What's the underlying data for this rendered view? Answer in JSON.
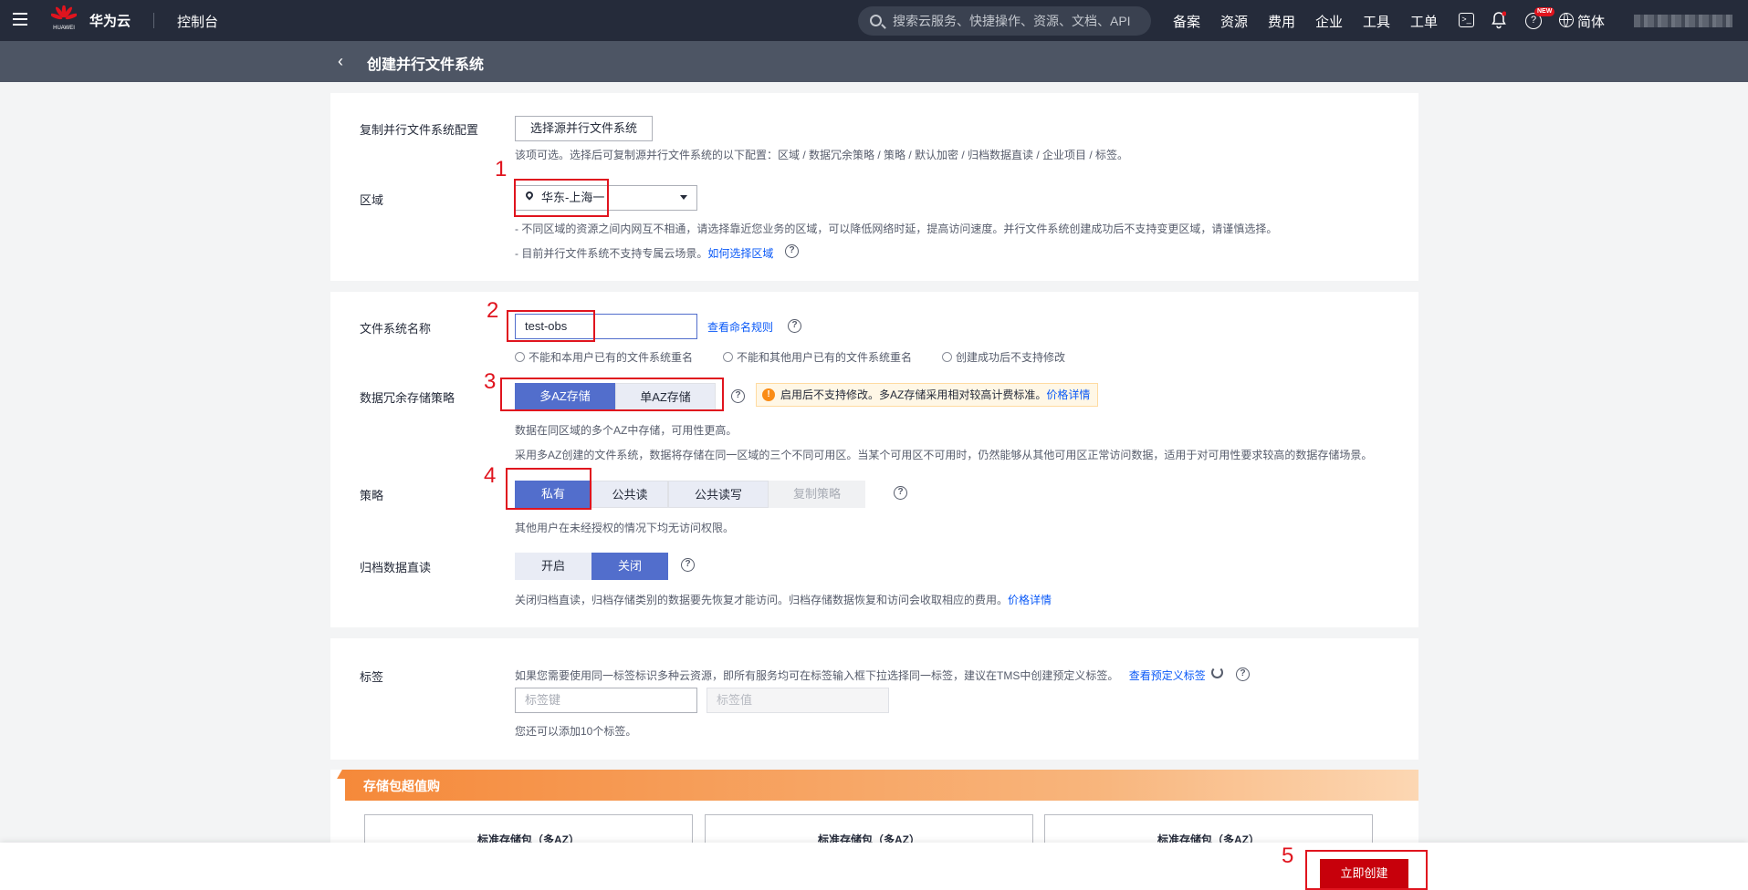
{
  "topnav": {
    "logo_text": "HUAWEI",
    "brand": "华为云",
    "console": "控制台",
    "search_placeholder": "搜索云服务、快捷操作、资源、文档、API",
    "menu": [
      "备案",
      "资源",
      "费用",
      "企业",
      "工具",
      "工单"
    ],
    "new_badge": "NEW",
    "language": "简体"
  },
  "subheader": {
    "title": "创建并行文件系统"
  },
  "copy_config": {
    "label": "复制并行文件系统配置",
    "button": "选择源并行文件系统",
    "hint": "该项可选。选择后可复制源并行文件系统的以下配置：区域 / 数据冗余策略 / 策略 / 默认加密 / 归档数据直读 / 企业项目 / 标签。"
  },
  "region": {
    "label": "区域",
    "value": "华东-上海一",
    "hint1": "- 不同区域的资源之间内网互不相通，请选择靠近您业务的区域，可以降低网络时延，提高访问速度。并行文件系统创建成功后不支持变更区域，请谨慎选择。",
    "hint2": "- 目前并行文件系统不支持专属云场景。",
    "hint2_link": "如何选择区域"
  },
  "fs_name": {
    "label": "文件系统名称",
    "value": "test-obs",
    "rule_link": "查看命名规则",
    "rules": [
      "不能和本用户已有的文件系统重名",
      "不能和其他用户已有的文件系统重名",
      "创建成功后不支持修改"
    ]
  },
  "redundancy": {
    "label": "数据冗余存储策略",
    "options": [
      "多AZ存储",
      "单AZ存储"
    ],
    "warning": "启用后不支持修改。多AZ存储采用相对较高计费标准。",
    "warning_link": "价格详情",
    "hint1": "数据在同区域的多个AZ中存储，可用性更高。",
    "hint2": "采用多AZ创建的文件系统，数据将存储在同一区域的三个不同可用区。当某个可用区不可用时，仍然能够从其他可用区正常访问数据，适用于对可用性要求较高的数据存储场景。"
  },
  "policy": {
    "label": "策略",
    "options": [
      "私有",
      "公共读",
      "公共读写",
      "复制策略"
    ],
    "hint": "其他用户在未经授权的情况下均无访问权限。"
  },
  "archive": {
    "label": "归档数据直读",
    "options": [
      "开启",
      "关闭"
    ],
    "hint": "关闭归档直读，归档存储类别的数据要先恢复才能访问。归档存储数据恢复和访问会收取相应的费用。",
    "hint_link": "价格详情"
  },
  "tags": {
    "label": "标签",
    "hint": "如果您需要使用同一标签标识多种云资源，即所有服务均可在标签输入框下拉选择同一标签，建议在TMS中创建预定义标签。",
    "link": "查看预定义标签",
    "key_placeholder": "标签键",
    "value_placeholder": "标签值",
    "more_hint": "您还可以添加10个标签。"
  },
  "package": {
    "banner": "存储包超值购",
    "cards": [
      "标准存储包（多AZ）",
      "标准存储包（多AZ）",
      "标准存储包（多AZ）"
    ]
  },
  "footer": {
    "create_button": "立即创建"
  },
  "annotations": [
    "1",
    "2",
    "3",
    "4",
    "5"
  ],
  "colors": {
    "primary": "#526ecc",
    "danger": "#c7000b",
    "annotation": "#e0141e",
    "nav": "#252b3a"
  }
}
